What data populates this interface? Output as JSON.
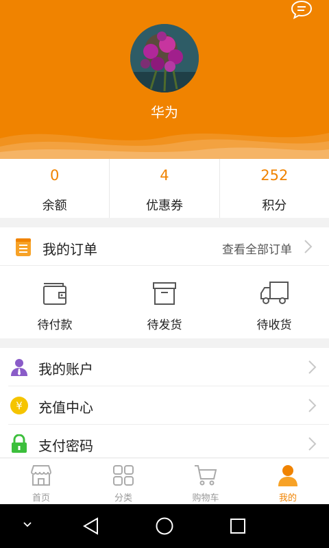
{
  "profile": {
    "username": "华为"
  },
  "stats": [
    {
      "value": "0",
      "label": "余额"
    },
    {
      "value": "4",
      "label": "优惠券"
    },
    {
      "value": "252",
      "label": "积分"
    }
  ],
  "orders": {
    "title": "我的订单",
    "view_all": "查看全部订单",
    "items": [
      {
        "label": "待付款",
        "icon": "wallet-icon"
      },
      {
        "label": "待发货",
        "icon": "package-box-icon"
      },
      {
        "label": "待收货",
        "icon": "delivery-truck-icon"
      }
    ]
  },
  "menu": [
    {
      "label": "我的账户",
      "icon": "user-account-icon",
      "color": "#8a5cc8"
    },
    {
      "label": "充值中心",
      "icon": "yuan-coin-icon",
      "color": "#f5c400"
    },
    {
      "label": "支付密码",
      "icon": "lock-icon",
      "color": "#3cbf3c"
    }
  ],
  "tabbar": [
    {
      "label": "首页",
      "icon": "home-store-icon",
      "active": false
    },
    {
      "label": "分类",
      "icon": "category-grid-icon",
      "active": false
    },
    {
      "label": "购物车",
      "icon": "shopping-cart-icon",
      "active": false
    },
    {
      "label": "我的",
      "icon": "profile-person-icon",
      "active": true
    }
  ],
  "colors": {
    "accent": "#f08300",
    "background": "#f2f2f2"
  }
}
